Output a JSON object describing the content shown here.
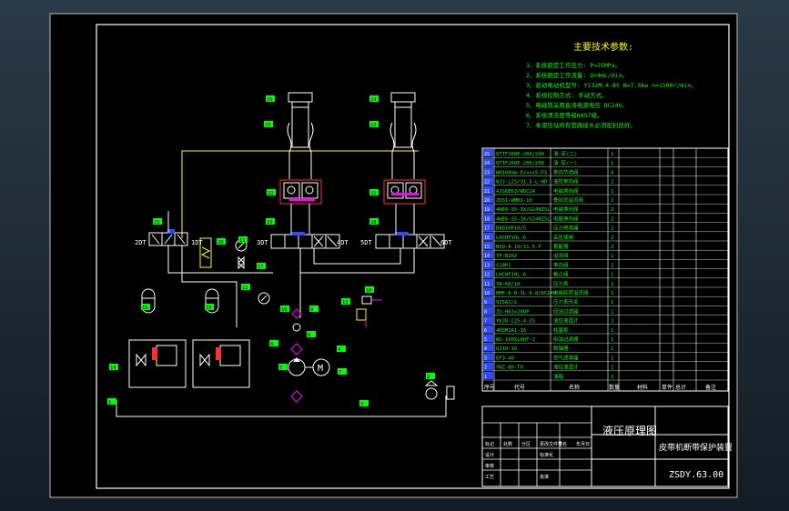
{
  "technical_requirements": {
    "title": "主要技术参数:",
    "lines": [
      "1、系统额定工作压力: P=25MPa。",
      "2、系统额定工作流量: Q=4mL/min。",
      "3、驱动电动机型号: Y132M-4-B5  N=7.5kw  n=1500r/min。",
      "4、系统控制方式: 手动方式。",
      "5、电磁铁采用直流电源电压 DC24V。",
      "6、系统清洁度等级NAS7级。",
      "7、本液压站所有管路接头必须密封良好。"
    ]
  },
  "parts_list": {
    "rows": [
      {
        "no": "25",
        "code": "QTTF100E-200/200",
        "name": "油  缸(二)",
        "qty": "1"
      },
      {
        "no": "24",
        "code": "QTTF100E-200/200",
        "name": "油  缸(一)",
        "qty": "1"
      },
      {
        "no": "23",
        "code": "WH100mm-Exxxx5-FS",
        "name": "单向节流阀",
        "qty": "4"
      },
      {
        "no": "22",
        "code": "WJJ-L25/31.5-L-HD",
        "name": "液控单向阀",
        "qty": "2"
      },
      {
        "no": "21",
        "code": "4JS6E63/WDC24",
        "name": "电磁换向阀",
        "qty": "1"
      },
      {
        "no": "20",
        "code": "ZDS1-WMB1-10",
        "name": "叠加式溢流阀",
        "qty": "1"
      },
      {
        "no": "19",
        "code": "4WE6-S5-3X/G24NZ5L",
        "name": "电磁换向阀",
        "qty": "2"
      },
      {
        "no": "18",
        "code": "4WE6-S5-3X/G24NZ5L",
        "name": "电磁换向阀",
        "qty": "2"
      },
      {
        "no": "17",
        "code": "DBD10P10/5",
        "name": "压力继电器",
        "qty": "2"
      },
      {
        "no": "16",
        "code": "LHCHF10L-6",
        "name": "高压球阀",
        "qty": "2"
      },
      {
        "no": "15",
        "code": "NXQ-A-10/31.5-F",
        "name": "蓄能器",
        "qty": "2"
      },
      {
        "no": "14",
        "code": "YF-B2H2",
        "name": "溢流阀",
        "qty": "1"
      },
      {
        "no": "13",
        "code": "S10P1",
        "name": "单向阀",
        "qty": "1"
      },
      {
        "no": "12",
        "code": "LHCHF10L-6",
        "name": "截止阀",
        "qty": "1"
      },
      {
        "no": "11",
        "code": "YN-60/10",
        "name": "压力表",
        "qty": "1"
      },
      {
        "no": "10",
        "code": "HMF-6-D-IL-0.8/DC24V",
        "name": "电磁卸荷溢流阀",
        "qty": "1"
      },
      {
        "no": "9",
        "code": "SI5A1/2",
        "name": "压力表开关",
        "qty": "1"
      },
      {
        "no": "8",
        "code": "ZU-H63x20DP",
        "name": "回油过滤器",
        "qty": "1"
      },
      {
        "no": "7",
        "code": "YKJD-C25-4-25",
        "name": "液位液温计",
        "qty": "1"
      },
      {
        "no": "6",
        "code": "4MSM1A1-16",
        "name": "柱塞泵",
        "qty": "1"
      },
      {
        "no": "5",
        "code": "WU-160X180F-J",
        "name": "吸油过滤器",
        "qty": "1"
      },
      {
        "no": "4",
        "code": "QJ10-16",
        "name": "联轴器",
        "qty": "1"
      },
      {
        "no": "3",
        "code": "EF3-40",
        "name": "空气滤清器",
        "qty": "1"
      },
      {
        "no": "2",
        "code": "YWZ-80-T0",
        "name": "液位液温计",
        "qty": "1"
      },
      {
        "no": "1",
        "code": "",
        "name": "油箱",
        "qty": "1"
      }
    ],
    "header": {
      "no": "序号",
      "code": "代号",
      "name": "名称",
      "qty": "数量",
      "material": "材料",
      "unit_weight": "单件",
      "total_weight": "总计",
      "remarks": "备注"
    }
  },
  "title_block": {
    "drawing_title": "液压原理图",
    "project_name": "皮带机断带保护装置",
    "drawing_number": "ZSDY.63.00",
    "rows": [
      [
        "标记",
        "处数",
        "分区",
        "更改文件号",
        "签名",
        "年月日"
      ],
      [
        "设计",
        "",
        "",
        "标准化"
      ],
      [
        "审核"
      ],
      [
        "工艺",
        "",
        "",
        "批准"
      ]
    ]
  },
  "schematic": {
    "valve_labels": [
      "2DT",
      "1DT",
      "3DT",
      "4DT",
      "5DT",
      "6DT"
    ],
    "part_tags": [
      "25",
      "24",
      "23",
      "23",
      "22",
      "22",
      "21",
      "20",
      "19",
      "18",
      "17",
      "16",
      "15",
      "15",
      "14",
      "13",
      "12",
      "11",
      "10",
      "9",
      "8",
      "7",
      "6",
      "5",
      "4",
      "3",
      "2",
      "1"
    ]
  },
  "colors": {
    "background": "#1a2530",
    "sheet": "#000000",
    "frame": "#ffffff",
    "green": "#00ff00",
    "yellow": "#ffff00",
    "magenta": "#ff00ff",
    "red": "#ff3030",
    "blue": "#2a4bff",
    "cyan": "#00ffff"
  }
}
